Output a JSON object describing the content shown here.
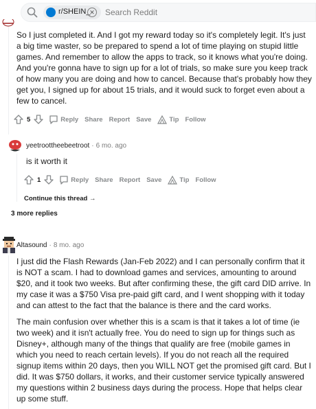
{
  "search": {
    "subreddit_chip": "r/SHEIN_",
    "placeholder": "Search Reddit"
  },
  "comments": [
    {
      "text": "So I just completed it. And I got my reward today so it's completely legit. It's just a big time waster, so be prepared to spend a lot of time playing on stupid little games. And remember to allow the apps to track, so it knows what you're doing. And you're gonna have to sign up for a lot of trials, so make sure you keep track of how many you are doing and how to cancel. Because that's probably how they get you, I signed up for about 15 trials, and it would suck to forget even about a few to cancel.",
      "votes": "5",
      "actions": {
        "reply": "Reply",
        "share": "Share",
        "report": "Report",
        "save": "Save",
        "tip": "Tip",
        "follow": "Follow"
      }
    },
    {
      "author": "yeetroottheebeetroot",
      "age": "6 mo. ago",
      "text": "is it worth it",
      "votes": "1",
      "actions": {
        "reply": "Reply",
        "share": "Share",
        "report": "Report",
        "save": "Save",
        "tip": "Tip",
        "follow": "Follow"
      },
      "continue_thread": "Continue this thread"
    },
    {
      "author": "Altasound",
      "age": "8 mo. ago",
      "paragraphs": [
        "I just did the Flash Rewards (Jan-Feb 2022) and I can personally confirm that it is NOT a scam. I had to download games and services, amounting to around $20, and it took two weeks. But after confirming these, the gift card DID arrive. In my case it was a $750 Visa pre-paid gift card, and I went shopping with it today and can attest to the fact that the balance is there and the card works.",
        "The main confusion over whether this is a scam is that it takes a lot of time (ie two week) and it isn't actually free. You do need to sign up for things such as Disney+, although many of the things that qualify are free (mobile games in which you need to reach certain levels). If you do not reach all the required signup items within 20 days, then you WILL NOT get the promised gift card. But I did. It was $750 dollars, it works, and their customer service typically answered my questions within 2 business days during the process. Hope that helps clear up some stuff."
      ]
    }
  ],
  "more_replies": "3 more replies",
  "colors": {
    "link_blue": "#0079d3",
    "meta_gray": "#878a8c",
    "text": "#1c1c1c"
  }
}
